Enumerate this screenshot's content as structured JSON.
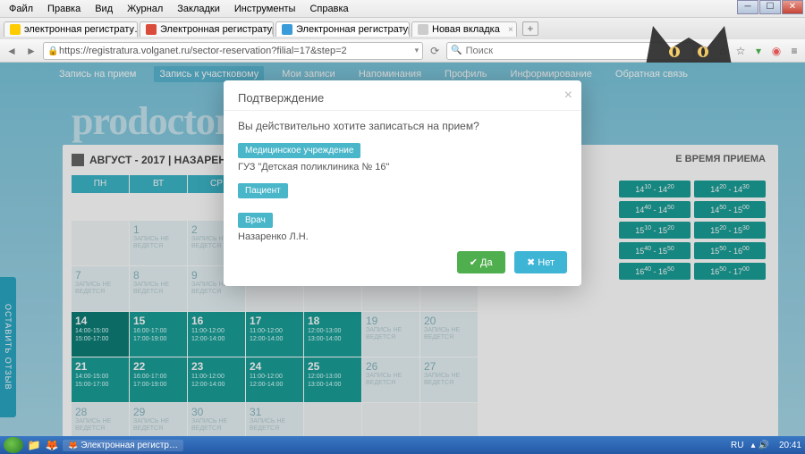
{
  "menubar": [
    "Файл",
    "Правка",
    "Вид",
    "Журнал",
    "Закладки",
    "Инструменты",
    "Справка"
  ],
  "tabs": [
    {
      "label": "электронная регистрату…",
      "favcolor": "#ffcc00"
    },
    {
      "label": "Электронная регистратура …",
      "favcolor": "#d94b3a"
    },
    {
      "label": "Электронная регистратура …",
      "favcolor": "#3a9bd9",
      "active": true
    },
    {
      "label": "Новая вкладка",
      "favcolor": "#ccc"
    }
  ],
  "url": "https://registratura.volganet.ru/sector-reservation?filial=17&step=2",
  "search_placeholder": "Поиск",
  "nav": [
    "Запись на прием",
    "Запись к участковому",
    "Мои записи",
    "Напоминания",
    "Профиль",
    "Информирование",
    "Обратная связь"
  ],
  "nav_active": 1,
  "watermark": "prodoctorov.ru",
  "panel_title": "АВГУСТ - 2017 | НАЗАРЕНКО Л",
  "freetime_label": "Е ВРЕМЯ ПРИЕМА",
  "weekdays": [
    "ПН",
    "ВТ",
    "СР"
  ],
  "cal_rows": [
    [
      {
        "d": "",
        "off": true
      },
      {
        "d": "1",
        "no": true
      },
      {
        "d": "2",
        "no": true
      }
    ],
    [
      {
        "d": "7",
        "no": true
      },
      {
        "d": "8",
        "no": true
      },
      {
        "d": "9",
        "no": true
      }
    ],
    [
      {
        "d": "14",
        "open": true,
        "today": true,
        "t": [
          "14:00-15:00",
          "15:00-17:00"
        ]
      },
      {
        "d": "15",
        "open": true,
        "t": [
          "16:00-17:00",
          "17:00-19:00"
        ]
      },
      {
        "d": "16",
        "open": true,
        "t": [
          "11:00-12:00",
          "12:00-14:00"
        ]
      },
      {
        "d": "17",
        "open": true,
        "t": [
          "11:00-12:00",
          "12:00-14:00"
        ]
      },
      {
        "d": "18",
        "open": true,
        "t": [
          "12:00-13:00",
          "13:00-14:00"
        ]
      },
      {
        "d": "19",
        "no": true
      },
      {
        "d": "20",
        "no": true
      }
    ],
    [
      {
        "d": "21",
        "open": true,
        "t": [
          "14:00-15:00",
          "15:00-17:00"
        ]
      },
      {
        "d": "22",
        "open": true,
        "t": [
          "16:00-17:00",
          "17:00-19:00"
        ]
      },
      {
        "d": "23",
        "open": true,
        "t": [
          "11:00-12:00",
          "12:00-14:00"
        ]
      },
      {
        "d": "24",
        "open": true,
        "t": [
          "11:00-12:00",
          "12:00-14:00"
        ]
      },
      {
        "d": "25",
        "open": true,
        "t": [
          "12:00-13:00",
          "13:00-14:00"
        ]
      },
      {
        "d": "26",
        "no": true
      },
      {
        "d": "27",
        "no": true
      }
    ],
    [
      {
        "d": "28",
        "no": true
      },
      {
        "d": "29",
        "no": true
      },
      {
        "d": "30",
        "no": true
      },
      {
        "d": "31",
        "no": true
      }
    ]
  ],
  "no_apt": "ЗАПИСЬ НЕ\nВЕДЕТСЯ",
  "slots": [
    [
      "14",
      "10",
      "14",
      "20"
    ],
    [
      "14",
      "20",
      "14",
      "30"
    ],
    [
      "14",
      "40",
      "14",
      "50"
    ],
    [
      "14",
      "50",
      "15",
      "00"
    ],
    [
      "15",
      "10",
      "15",
      "20"
    ],
    [
      "15",
      "20",
      "15",
      "30"
    ],
    [
      "15",
      "40",
      "15",
      "50"
    ],
    [
      "15",
      "50",
      "16",
      "00"
    ],
    [
      "16",
      "40",
      "16",
      "50"
    ],
    [
      "16",
      "50",
      "17",
      "00"
    ]
  ],
  "modal": {
    "title": "Подтверждение",
    "question": "Вы действительно хотите записаться на прием?",
    "badge_inst": "Медицинское учреждение",
    "inst": "ГУЗ \"Детская поликлиника № 16\"",
    "badge_patient": "Пациент",
    "patient": " ",
    "badge_doctor": "Врач",
    "doctor": "Назаренко Л.Н.",
    "yes": "Да",
    "no": "Нет"
  },
  "feedback": "ОСТАВИТЬ ОТЗЫВ",
  "taskbar_item": "Электронная регистр…",
  "lang": "RU",
  "clock": "20:41"
}
